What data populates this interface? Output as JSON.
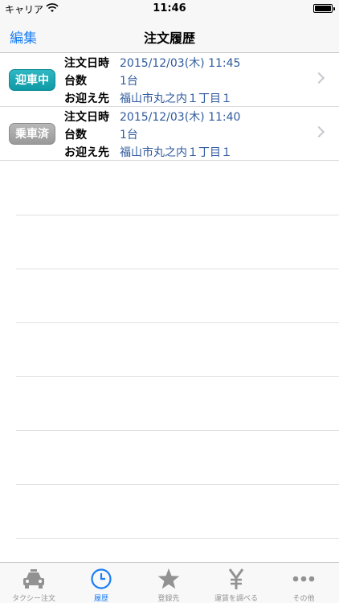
{
  "status": {
    "carrier": "キャリア",
    "time": "11:46"
  },
  "nav": {
    "edit": "編集",
    "title": "注文履歴"
  },
  "labels": {
    "date": "注文日時",
    "count": "台数",
    "pickup": "お迎え先"
  },
  "orders": [
    {
      "status": "迎車中",
      "date": "2015/12/03(木) 11:45",
      "count": "1台",
      "pickup": "福山市丸之内１丁目１"
    },
    {
      "status": "乗車済",
      "date": "2015/12/03(木) 11:40",
      "count": "1台",
      "pickup": "福山市丸之内１丁目１"
    }
  ],
  "tabs": [
    {
      "label": "タクシー注文",
      "icon": "taxi-icon"
    },
    {
      "label": "履歴",
      "icon": "clock-icon"
    },
    {
      "label": "登録先",
      "icon": "star-icon"
    },
    {
      "label": "運賃を調べる",
      "icon": "yen-icon"
    },
    {
      "label": "その他",
      "icon": "more-icon"
    }
  ],
  "colors": {
    "accent": "#1a7ef5",
    "active_badge": "#14a5b0",
    "done_badge": "#a8a8a8",
    "value_text": "#2f5a9e"
  }
}
